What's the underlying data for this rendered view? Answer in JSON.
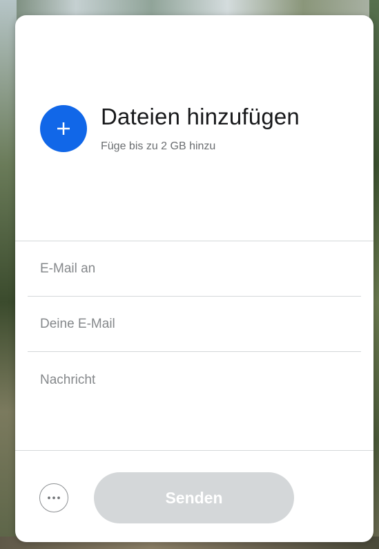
{
  "upload": {
    "title": "Dateien hinzufügen",
    "subtitle": "Füge bis zu 2 GB hinzu",
    "add_icon": "plus-icon"
  },
  "form": {
    "email_to_placeholder": "E-Mail an",
    "your_email_placeholder": "Deine E-Mail",
    "message_placeholder": "Nachricht"
  },
  "actions": {
    "more_icon": "more-options-icon",
    "send_label": "Senden",
    "send_enabled": false
  },
  "colors": {
    "accent": "#1167e8",
    "send_disabled_bg": "#d4d7d9",
    "card_bg": "#ffffff",
    "divider": "#d4d7d9"
  }
}
